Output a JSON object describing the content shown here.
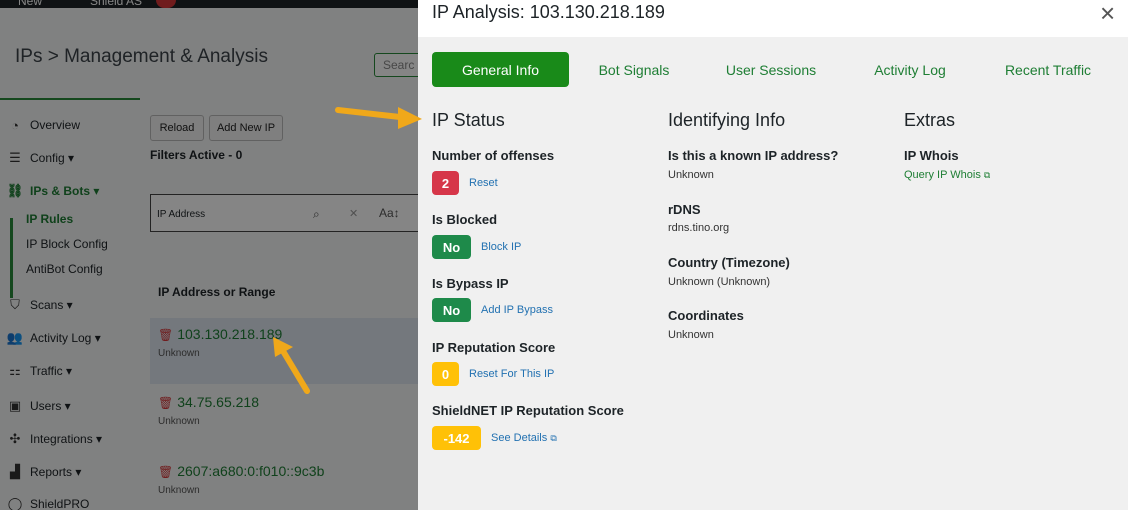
{
  "adminbar": {
    "new_label": "New",
    "plugin_label": "Shield AS"
  },
  "background": {
    "page_title": "IPs > Management & Analysis",
    "search_stub": "Searc",
    "nav": [
      {
        "label": "Overview",
        "icon": "dashboard-icon"
      },
      {
        "label": "Config ▾",
        "icon": "sliders-icon"
      },
      {
        "label": "IPs & Bots ▾",
        "icon": "network-icon"
      },
      {
        "label": "Scans ▾",
        "icon": "shield-icon"
      },
      {
        "label": "Activity Log ▾",
        "icon": "users-icon"
      },
      {
        "label": "Traffic ▾",
        "icon": "traffic-icon"
      },
      {
        "label": "Users ▾",
        "icon": "user-icon"
      },
      {
        "label": "Integrations ▾",
        "icon": "puzzle-icon"
      },
      {
        "label": "Reports ▾",
        "icon": "bar-chart-icon"
      },
      {
        "label": "ShieldPRO",
        "icon": "shield-pro-icon"
      }
    ],
    "subnav": [
      "IP Rules",
      "IP Block Config",
      "AntiBot Config"
    ],
    "buttons": {
      "reload": "Reload",
      "add_new_ip": "Add New IP"
    },
    "filters_active": "Filters Active - 0",
    "ip_field_placeholder": "IP Address",
    "column_header": "IP Address or Range",
    "rows": [
      {
        "ip": "103.130.218.189",
        "sub": "Unknown"
      },
      {
        "ip": "34.75.65.218",
        "sub": "Unknown"
      },
      {
        "ip": "2607:a680:0:f010::9c3b",
        "sub": "Unknown"
      }
    ]
  },
  "modal": {
    "title": "IP Analysis: 103.130.218.189",
    "tabs": [
      "General Info",
      "Bot Signals",
      "User Sessions",
      "Activity Log",
      "Recent Traffic"
    ],
    "ip_status": {
      "heading": "IP Status",
      "offenses_label": "Number of offenses",
      "offenses_value": "2",
      "offenses_action": "Reset",
      "blocked_label": "Is Blocked",
      "blocked_value": "No",
      "blocked_action": "Block IP",
      "bypass_label": "Is Bypass IP",
      "bypass_value": "No",
      "bypass_action": "Add IP Bypass",
      "reputation_label": "IP Reputation Score",
      "reputation_value": "0",
      "reputation_action": "Reset For This IP",
      "shieldnet_label": "ShieldNET IP Reputation Score",
      "shieldnet_value": "-142",
      "shieldnet_action": "See Details"
    },
    "identifying": {
      "heading": "Identifying Info",
      "known_label": "Is this a known IP address?",
      "known_value": "Unknown",
      "rdns_label": "rDNS",
      "rdns_value": "rdns.tino.org",
      "country_label": "Country (Timezone)",
      "country_value": "Unknown (Unknown)",
      "coords_label": "Coordinates",
      "coords_value": "Unknown"
    },
    "extras": {
      "heading": "Extras",
      "whois_label": "IP Whois",
      "whois_link": "Query IP Whois"
    }
  },
  "colors": {
    "accent_green": "#198a19",
    "badge_red": "#d63649",
    "badge_green": "#1e8a4a",
    "badge_yellow": "#ffc107",
    "link_blue": "#2271b1",
    "arrow_orange": "#f0a81a"
  }
}
